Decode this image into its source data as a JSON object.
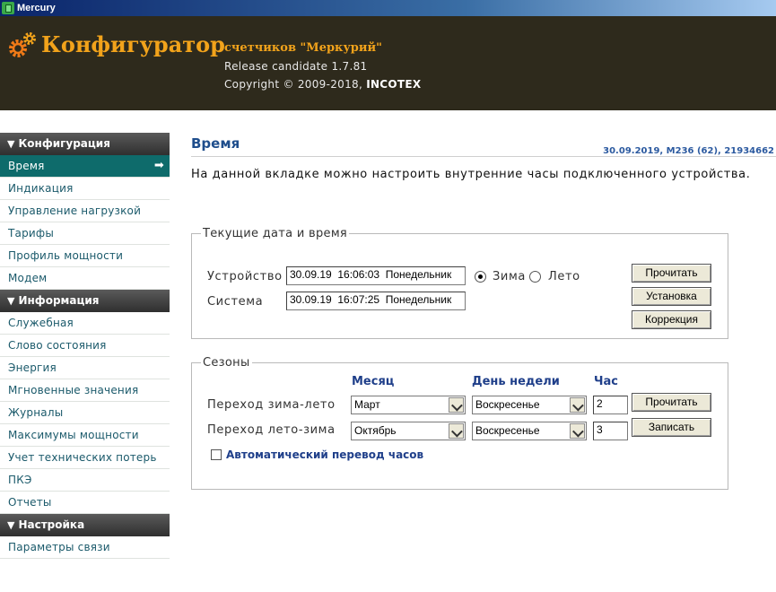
{
  "window": {
    "title": "Mercury"
  },
  "header": {
    "brand": "Конфигуратор",
    "subtitle": "счетчиков \"Меркурий\"",
    "release": "Release candidate 1.7.81",
    "copyright_prefix": "Copyright © 2009-2018, ",
    "copyright_company": "INCOTEX",
    "accent_color": "#f2a31b"
  },
  "sidebar": {
    "sections": [
      {
        "title": "Конфигурация",
        "items": [
          "Время",
          "Индикация",
          "Управление нагрузкой",
          "Тарифы",
          "Профиль мощности",
          "Модем"
        ]
      },
      {
        "title": "Информация",
        "items": [
          "Служебная",
          "Слово состояния",
          "Энергия",
          "Мгновенные значения",
          "Журналы",
          "Максимумы мощности",
          "Учет технических потерь",
          "ПКЭ",
          "Отчеты"
        ]
      },
      {
        "title": "Настройка",
        "items": [
          "Параметры связи"
        ]
      }
    ],
    "active_item": "Время"
  },
  "main": {
    "title": "Время",
    "status": "30.09.2019, М236 (62), 21934662",
    "description": "На данной вкладке можно настроить внутренние часы подключенного устройства."
  },
  "current_time": {
    "legend": "Текущие дата и время",
    "device_label": "Устройство",
    "device_value": "30.09.19  16:06:03  Понедельник",
    "system_label": "Система",
    "system_value": "30.09.19  16:07:25  Понедельник",
    "winter_label": "Зима",
    "summer_label": "Лето",
    "selected_season": "winter",
    "read_button": "Прочитать",
    "set_button": "Установка",
    "correct_button": "Коррекция"
  },
  "seasons": {
    "legend": "Сезоны",
    "col_month": "Месяц",
    "col_weekday": "День недели",
    "col_hour": "Час",
    "rows": [
      {
        "label": "Переход зима-лето",
        "month": "Март",
        "weekday": "Воскресенье",
        "hour": "2"
      },
      {
        "label": "Переход лето-зима",
        "month": "Октябрь",
        "weekday": "Воскресенье",
        "hour": "3"
      }
    ],
    "read_button": "Прочитать",
    "write_button": "Записать",
    "auto_switch_label": "Автоматический перевод часов",
    "auto_switch_checked": false
  }
}
